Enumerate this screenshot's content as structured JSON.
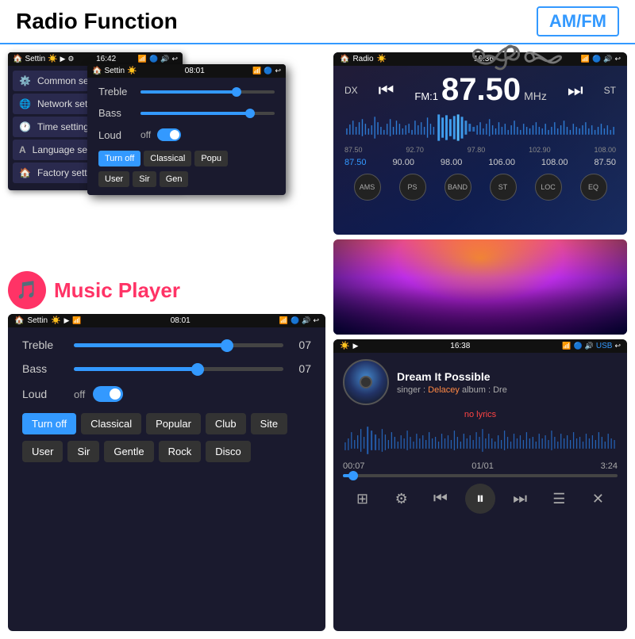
{
  "header": {
    "title": "Radio Function",
    "badge": "AM/FM"
  },
  "settings_panel": {
    "bar_title": "Settin",
    "bar_time": "16:42",
    "menu_items": [
      {
        "label": "Common settings",
        "icon": "⚙️"
      },
      {
        "label": "Network setting",
        "icon": "🌐"
      },
      {
        "label": "Time setting",
        "icon": "🕐"
      },
      {
        "label": "Language setting",
        "icon": "A"
      },
      {
        "label": "Factory setting",
        "icon": "🏠"
      }
    ]
  },
  "eq_panel": {
    "bar_title": "Settin",
    "bar_time": "08:01",
    "treble_label": "Treble",
    "bass_label": "Bass",
    "loud_label": "Loud",
    "loud_off": "off",
    "buttons_row1": [
      "Turn off",
      "Classical",
      "Popu"
    ],
    "buttons_row2": [
      "User",
      "Sir",
      "Gen"
    ]
  },
  "music_section": {
    "title": "Music Player"
  },
  "big_eq": {
    "bar_title": "Settin",
    "bar_time": "08:01",
    "treble_label": "Treble",
    "treble_val": "07",
    "bass_label": "Bass",
    "bass_val": "07",
    "loud_label": "Loud",
    "loud_off": "off",
    "buttons_row1": [
      "Turn off",
      "Classical",
      "Popular",
      "Club",
      "Site"
    ],
    "buttons_row2": [
      "User",
      "Sir",
      "Gentle",
      "Rock",
      "Disco"
    ]
  },
  "radio": {
    "bar_title": "Radio",
    "bar_time": "16:36",
    "dx": "DX",
    "fm_label": "FM:1",
    "frequency": "87.50",
    "unit": "MHz",
    "st": "ST",
    "scale": [
      "87.50",
      "92.70",
      "97.80",
      "102.90",
      "108.00"
    ],
    "stations": [
      "87.50",
      "90.00",
      "98.00",
      "106.00",
      "108.00",
      "87.50"
    ],
    "controls": [
      "AMS",
      "PS",
      "BAND",
      "ST",
      "LOC",
      "EQ"
    ]
  },
  "music_player": {
    "bar_time": "16:38",
    "usb_label": "USB",
    "song_title": "Dream It Possible",
    "singer_label": "singer :",
    "singer": "Delacey",
    "album_label": "album :",
    "album": "Dre",
    "no_lyrics": "no lyrics",
    "current_time": "00:07",
    "total_time": "3:24",
    "track_count": "01/01"
  }
}
